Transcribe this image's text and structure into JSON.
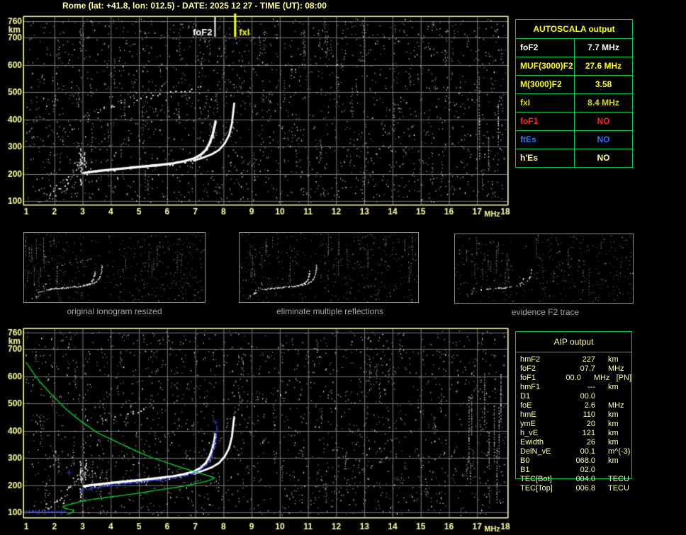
{
  "title": "Rome (lat: +41.8, lon: 012.5) - DATE: 2025 12 27 - TIME (UT): 08:00",
  "colors": {
    "axis_yellow": "#ffff9c",
    "grid_gray": "#7a7a7a",
    "trace_white": "#ffffff",
    "restored_blue": "#3340ff",
    "profile_green": "#00cc22",
    "marker_fof2": "#ffffff",
    "marker_fxi": "#ffff00",
    "table_green": "#00cc44",
    "caption_gray": "#a6a6a6"
  },
  "autoscala_table": {
    "header": "AUTOSCALA output",
    "rows": [
      {
        "label": "foF2",
        "value": "7.7 MHz",
        "color": "#ffffff"
      },
      {
        "label": "MUF(3000)F2",
        "value": "27.6 MHz",
        "color": "#ffff00"
      },
      {
        "label": "M(3000)F2",
        "value": "3.58",
        "color": "#ffff00"
      },
      {
        "label": "fxI",
        "value": "8.4 MHz",
        "color": "#d8d800"
      },
      {
        "label": "foF1",
        "value": "NO",
        "color": "#ff2222"
      },
      {
        "label": "ftEs",
        "value": "NO",
        "color": "#2277ff"
      },
      {
        "label": "h'Es",
        "value": "NO",
        "color": "#ffff9e"
      }
    ]
  },
  "aip_table": {
    "header": "AIP output",
    "rows": [
      {
        "label": "hmF2",
        "value": "227",
        "unit": "km"
      },
      {
        "label": "foF2",
        "value": "07.7",
        "unit": "MHz"
      },
      {
        "label": "foF1",
        "value": "00.0",
        "unit": "MHz   [PN]"
      },
      {
        "label": "hmF1",
        "value": "---",
        "unit": "km"
      },
      {
        "label": "D1",
        "value": "00.0",
        "unit": ""
      },
      {
        "label": "foE",
        "value": "2.6",
        "unit": "MHz"
      },
      {
        "label": "hmE",
        "value": "110",
        "unit": "km"
      },
      {
        "label": "ymE",
        "value": "20",
        "unit": "km"
      },
      {
        "label": "h_vE",
        "value": "121",
        "unit": "km"
      },
      {
        "label": "Ewidth",
        "value": "26",
        "unit": "km"
      },
      {
        "label": "DelN_vE",
        "value": "00.1",
        "unit": "m^(-3)"
      },
      {
        "label": "B0",
        "value": "068.0",
        "unit": "km"
      },
      {
        "label": "B1",
        "value": "02.0",
        "unit": ""
      },
      {
        "label": "TEC[Bot]",
        "value": "004.0",
        "unit": "TECU"
      },
      {
        "label": "TEC[Top]",
        "value": "006.8",
        "unit": "TECU"
      }
    ]
  },
  "thumbnails": [
    {
      "caption": "original ionogram resized"
    },
    {
      "caption": "eliminate multiple reflections"
    },
    {
      "caption": "evidence F2 trace"
    }
  ],
  "chart_data": [
    {
      "id": "top_ionogram",
      "type": "scatter",
      "xlabel": "MHz",
      "ylabel": "km",
      "x_ticks": [
        1,
        2,
        3,
        4,
        5,
        6,
        7,
        8,
        9,
        10,
        11,
        12,
        13,
        14,
        15,
        16,
        17,
        18
      ],
      "y_ticks": [
        100,
        200,
        300,
        400,
        500,
        600,
        700,
        760
      ],
      "xlim": [
        0.93,
        18.08
      ],
      "ylim": [
        87,
        775
      ],
      "grid": true,
      "markers": [
        {
          "name": "foF2",
          "x_mhz": 7.7,
          "color": "#ffffff",
          "label_side": "left"
        },
        {
          "name": "fxI",
          "x_mhz": 8.4,
          "color": "#ffff00",
          "label_side": "right"
        }
      ],
      "traces": {
        "echo_main": [
          [
            3.05,
            203
          ],
          [
            3.4,
            208
          ],
          [
            3.9,
            214
          ],
          [
            4.5,
            220
          ],
          [
            5.1,
            226
          ],
          [
            5.7,
            232
          ],
          [
            6.2,
            238
          ],
          [
            6.6,
            246
          ],
          [
            6.95,
            256
          ],
          [
            7.2,
            270
          ],
          [
            7.38,
            288
          ],
          [
            7.52,
            315
          ],
          [
            7.62,
            345
          ],
          [
            7.68,
            372
          ],
          [
            7.72,
            392
          ]
        ],
        "echo_xmode": [
          [
            6.95,
            248
          ],
          [
            7.3,
            260
          ],
          [
            7.6,
            272
          ],
          [
            7.85,
            288
          ],
          [
            8.05,
            312
          ],
          [
            8.2,
            342
          ],
          [
            8.3,
            385
          ],
          [
            8.35,
            430
          ],
          [
            8.38,
            458
          ]
        ],
        "second_hop": [
          [
            3.05,
            415
          ],
          [
            3.5,
            432
          ],
          [
            4.0,
            448
          ],
          [
            4.5,
            462
          ],
          [
            5.0,
            474
          ],
          [
            5.5,
            486
          ],
          [
            6.0,
            496
          ],
          [
            6.5,
            505
          ],
          [
            6.9,
            512
          ],
          [
            7.3,
            528
          ]
        ],
        "e_scatter_spine": [
          [
            1.7,
            120
          ],
          [
            2.0,
            135
          ],
          [
            2.2,
            150
          ],
          [
            2.35,
            165
          ],
          [
            2.5,
            185
          ],
          [
            2.65,
            205
          ],
          [
            2.78,
            225
          ],
          [
            2.9,
            245
          ],
          [
            2.95,
            265
          ]
        ],
        "e_spikes": [
          {
            "x_mhz": 2.93,
            "km_from": 150,
            "km_to": 295
          },
          {
            "x_mhz": 3.08,
            "km_from": 230,
            "km_to": 300
          }
        ]
      }
    },
    {
      "id": "bottom_ionogram",
      "type": "scatter",
      "xlabel": "MHz",
      "ylabel": "km",
      "x_ticks": [
        1,
        2,
        3,
        4,
        5,
        6,
        7,
        8,
        9,
        10,
        11,
        12,
        13,
        14,
        15,
        16,
        17,
        18
      ],
      "y_ticks": [
        100,
        200,
        300,
        400,
        500,
        600,
        700,
        760
      ],
      "xlim": [
        0.93,
        18.08
      ],
      "ylim": [
        87,
        775
      ],
      "grid": true,
      "markers": [],
      "traces": {
        "echo_main": [
          [
            3.05,
            196
          ],
          [
            3.4,
            201
          ],
          [
            3.9,
            207
          ],
          [
            4.5,
            213
          ],
          [
            5.1,
            219
          ],
          [
            5.7,
            226
          ],
          [
            6.2,
            232
          ],
          [
            6.6,
            240
          ],
          [
            6.95,
            250
          ],
          [
            7.2,
            264
          ],
          [
            7.38,
            282
          ],
          [
            7.52,
            308
          ],
          [
            7.62,
            338
          ],
          [
            7.68,
            365
          ],
          [
            7.71,
            385
          ]
        ],
        "echo_xmode": [
          [
            6.95,
            242
          ],
          [
            7.3,
            254
          ],
          [
            7.6,
            266
          ],
          [
            7.85,
            282
          ],
          [
            8.05,
            306
          ],
          [
            8.2,
            336
          ],
          [
            8.3,
            378
          ],
          [
            8.35,
            424
          ],
          [
            8.38,
            450
          ]
        ],
        "second_hop": [
          [
            3.3,
            420
          ],
          [
            3.8,
            440
          ],
          [
            4.3,
            456
          ],
          [
            4.8,
            468
          ],
          [
            5.2,
            478
          ]
        ],
        "e_scatter_spine": [
          [
            1.7,
            118
          ],
          [
            2.0,
            132
          ],
          [
            2.2,
            146
          ],
          [
            2.35,
            162
          ],
          [
            2.5,
            182
          ],
          [
            2.65,
            202
          ],
          [
            2.78,
            222
          ],
          [
            2.9,
            242
          ],
          [
            2.95,
            260
          ]
        ],
        "e_spikes": [
          {
            "x_mhz": 2.93,
            "km_from": 145,
            "km_to": 290
          },
          {
            "x_mhz": 3.08,
            "km_from": 225,
            "km_to": 295
          }
        ],
        "restored_flat": [
          [
            1.0,
            102
          ],
          [
            2.42,
            102
          ]
        ],
        "restored_trace": [
          [
            2.9,
            182
          ],
          [
            3.3,
            191
          ],
          [
            3.9,
            200
          ],
          [
            4.5,
            208
          ],
          [
            5.1,
            215
          ],
          [
            5.7,
            222
          ],
          [
            6.2,
            229
          ],
          [
            6.6,
            237
          ],
          [
            6.95,
            247
          ],
          [
            7.2,
            260
          ],
          [
            7.38,
            278
          ],
          [
            7.52,
            304
          ],
          [
            7.62,
            334
          ],
          [
            7.68,
            362
          ],
          [
            7.71,
            384
          ],
          [
            7.73,
            403
          ],
          [
            7.74,
            418
          ]
        ],
        "restored_marks": [
          [
            7.72,
            430
          ],
          [
            2.52,
            245
          ]
        ],
        "profile_green": [
          [
            1.0,
            650
          ],
          [
            1.4,
            590
          ],
          [
            1.85,
            538
          ],
          [
            2.4,
            480
          ],
          [
            2.85,
            442
          ],
          [
            3.5,
            394
          ],
          [
            4.1,
            364
          ],
          [
            4.8,
            330
          ],
          [
            5.4,
            303
          ],
          [
            6.0,
            282
          ],
          [
            6.5,
            265
          ],
          [
            7.0,
            249
          ],
          [
            7.35,
            238
          ],
          [
            7.6,
            230
          ],
          [
            7.68,
            227
          ],
          [
            7.55,
            219
          ],
          [
            7.3,
            212
          ],
          [
            6.9,
            203
          ],
          [
            6.4,
            193
          ],
          [
            5.8,
            184
          ],
          [
            5.1,
            172
          ],
          [
            4.4,
            162
          ],
          [
            3.8,
            154
          ],
          [
            3.3,
            147
          ],
          [
            2.95,
            141
          ],
          [
            2.7,
            133
          ],
          [
            2.45,
            127
          ],
          [
            2.3,
            121
          ],
          [
            2.35,
            116
          ],
          [
            2.5,
            112
          ],
          [
            2.62,
            110
          ],
          [
            2.68,
            106
          ],
          [
            2.65,
            101
          ],
          [
            2.55,
            96
          ],
          [
            2.45,
            92
          ]
        ]
      }
    }
  ]
}
